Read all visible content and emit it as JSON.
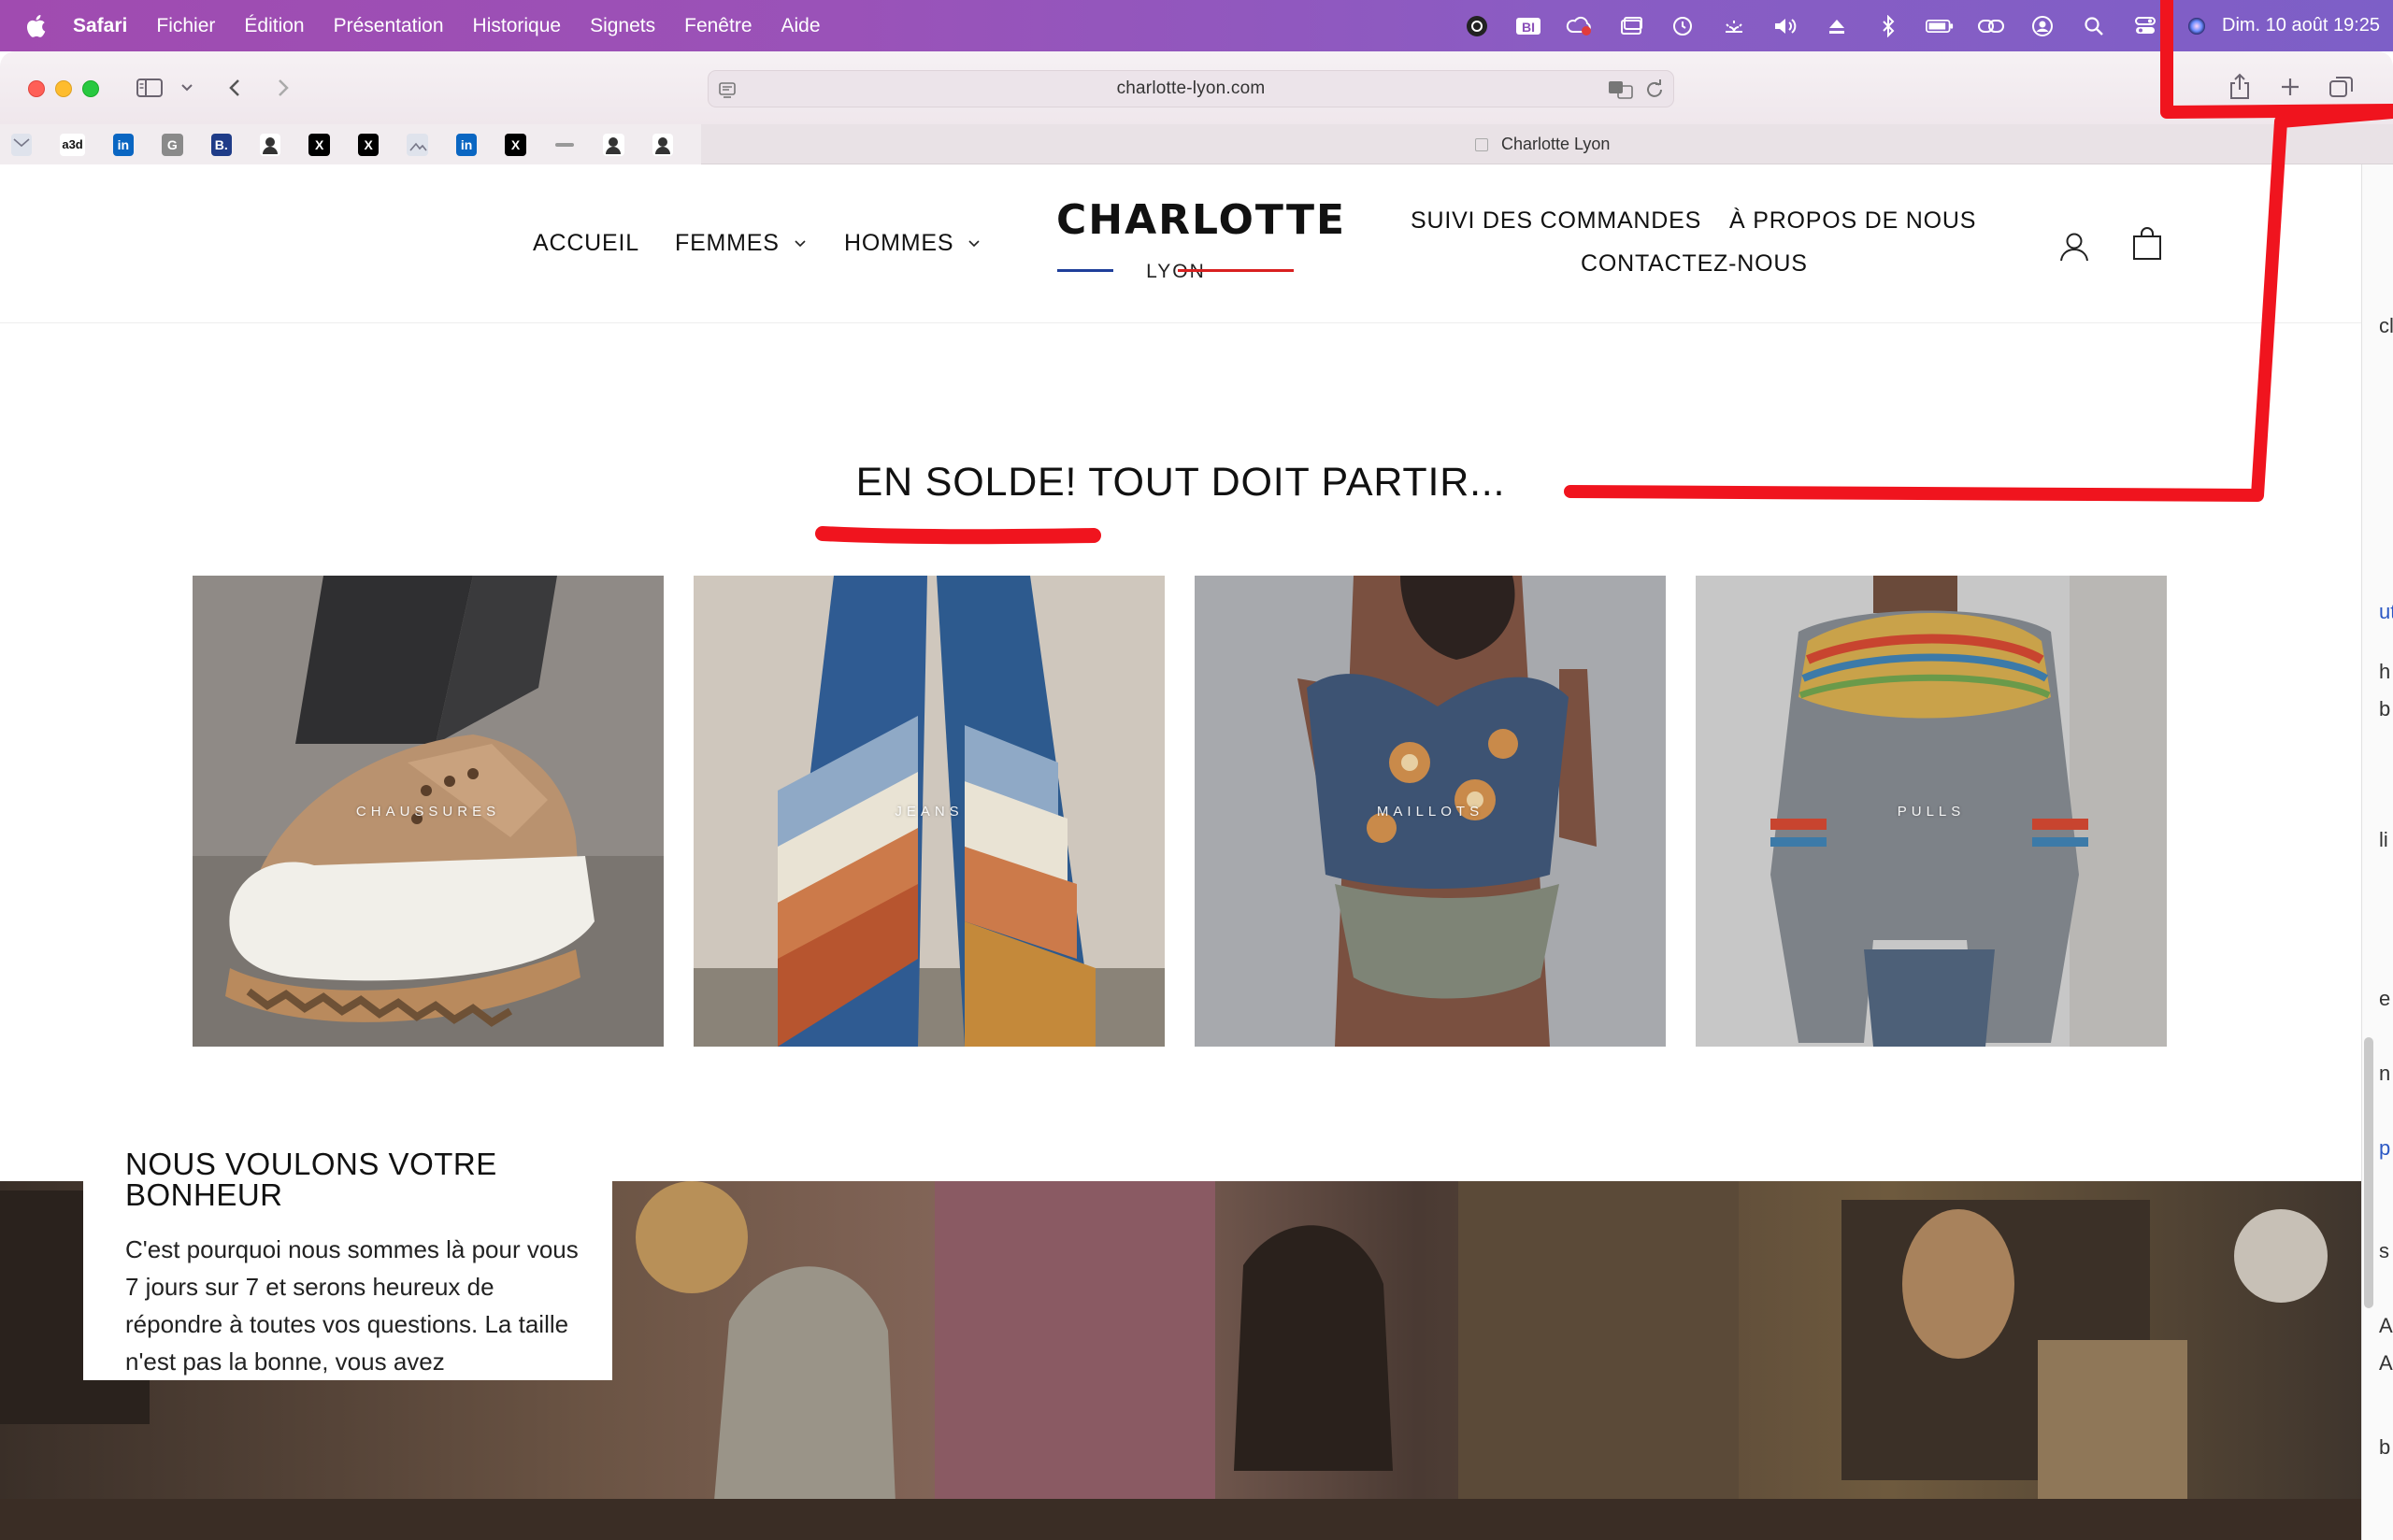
{
  "menubar": {
    "app": "Safari",
    "items": [
      "Fichier",
      "Édition",
      "Présentation",
      "Historique",
      "Signets",
      "Fenêtre",
      "Aide"
    ],
    "clock": "Dim. 10 août  19:25",
    "status_icons": [
      "creative-cloud-icon",
      "bi-icon",
      "cloud-sync-icon",
      "window-icon",
      "time-machine-icon",
      "brightness-icon",
      "volume-icon",
      "eject-icon",
      "bluetooth-icon",
      "battery-icon",
      "link-icon",
      "user-icon",
      "spotlight-search-icon",
      "control-center-icon",
      "siri-icon"
    ]
  },
  "browser": {
    "url": "charlotte-lyon.com",
    "tab_title": "Charlotte Lyon",
    "favorites": [
      "a3d",
      "in",
      "G",
      "B.",
      "X",
      "X",
      "in",
      "X"
    ]
  },
  "site": {
    "nav_left": [
      "ACCUEIL",
      "FEMMES",
      "HOMMES"
    ],
    "logo_name": "CHARLOTTE",
    "logo_city": "LYON",
    "nav_right": [
      "SUIVI DES COMMANDES",
      "À PROPOS DE NOUS",
      "CONTACTEZ-NOUS"
    ],
    "colors": {
      "logo_blue": "#1f3f9a",
      "logo_red": "#d92020",
      "annotation_red": "#f0141e"
    }
  },
  "sale": {
    "title": "EN SOLDE! TOUT DOIT PARTIR...",
    "categories": [
      "CHAUSSURES",
      "JEANS",
      "MAILLOTS",
      "PULLS"
    ]
  },
  "about": {
    "title": "NOUS VOULONS VOTRE BONHEUR",
    "text": "C'est pourquoi nous sommes là pour vous 7 jours sur 7 et serons heureux de répondre à toutes vos questions. La taille n'est pas la bonne, vous avez"
  },
  "side_strip": [
    "cl",
    "ut",
    "h",
    "b",
    "li",
    "e",
    "n",
    "p",
    "s",
    "A",
    "A",
    "b"
  ]
}
